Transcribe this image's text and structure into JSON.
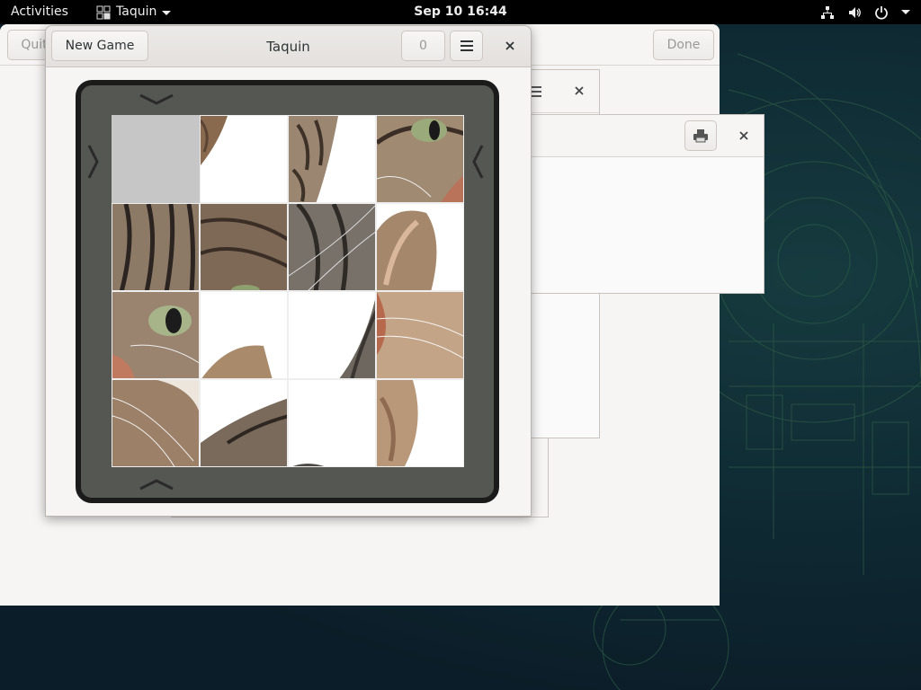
{
  "topbar": {
    "activities": "Activities",
    "app_name": "Taquin",
    "clock": "Sep 10  16:44",
    "tray_icons": [
      "network-icon",
      "volume-icon",
      "power-icon"
    ]
  },
  "background_window": {
    "quit_label": "Quit",
    "done_label": "Done"
  },
  "taquin": {
    "title": "Taquin",
    "new_game_label": "New Game",
    "moves": "0",
    "menu_icon": "hamburger-menu-icon",
    "close_icon": "close-icon",
    "board": {
      "size": 4,
      "empty_index": 0,
      "tiles": [
        {
          "row": 1,
          "col": 1,
          "kind": "empty"
        },
        {
          "row": 1,
          "col": 2,
          "kind": "fur-edge"
        },
        {
          "row": 1,
          "col": 3,
          "kind": "fur-stripes"
        },
        {
          "row": 1,
          "col": 4,
          "kind": "eye-right"
        },
        {
          "row": 2,
          "col": 1,
          "kind": "forehead"
        },
        {
          "row": 2,
          "col": 2,
          "kind": "fur-dense"
        },
        {
          "row": 2,
          "col": 3,
          "kind": "whiskers-gray"
        },
        {
          "row": 2,
          "col": 4,
          "kind": "ear-right"
        },
        {
          "row": 3,
          "col": 1,
          "kind": "eye-left"
        },
        {
          "row": 3,
          "col": 2,
          "kind": "ear-tip"
        },
        {
          "row": 3,
          "col": 3,
          "kind": "cheek-edge"
        },
        {
          "row": 3,
          "col": 4,
          "kind": "muzzle"
        },
        {
          "row": 4,
          "col": 1,
          "kind": "chin-whiskers"
        },
        {
          "row": 4,
          "col": 2,
          "kind": "neck"
        },
        {
          "row": 4,
          "col": 3,
          "kind": "blank-white"
        },
        {
          "row": 4,
          "col": 4,
          "kind": "ear-back"
        }
      ]
    }
  },
  "colors": {
    "board_bg": "#555753",
    "board_border": "#1b1b1b",
    "empty_tile": "#c6c6c6"
  }
}
